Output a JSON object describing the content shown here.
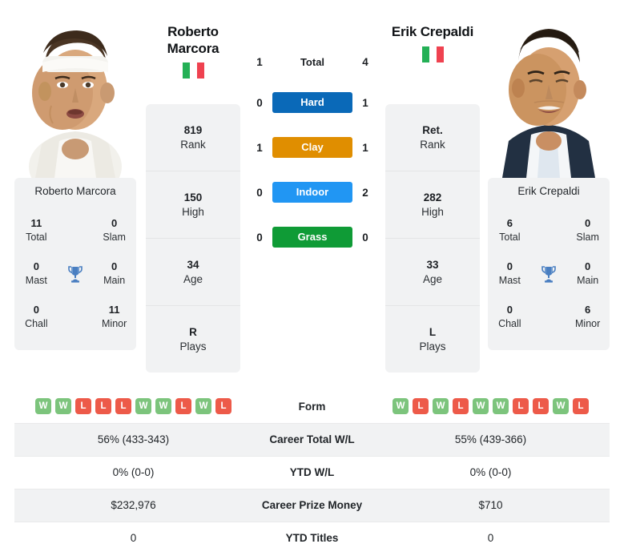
{
  "players": {
    "left": {
      "first_name": "Roberto",
      "last_name": "Marcora",
      "full_name": "Roberto Marcora",
      "country": "Italy",
      "flag_icon": "italy-flag-icon",
      "photo_alt": "Roberto Marcora headshot",
      "info": [
        {
          "value": "819",
          "label": "Rank"
        },
        {
          "value": "150",
          "label": "High"
        },
        {
          "value": "34",
          "label": "Age"
        },
        {
          "value": "R",
          "label": "Plays"
        }
      ],
      "titles": [
        {
          "value": "11",
          "label": "Total"
        },
        {
          "value": "0",
          "label": "Slam"
        },
        {
          "value": "0",
          "label": "Mast"
        },
        {
          "value": "0",
          "label": "Main"
        },
        {
          "value": "0",
          "label": "Chall"
        },
        {
          "value": "11",
          "label": "Minor"
        }
      ],
      "form": [
        "W",
        "W",
        "L",
        "L",
        "L",
        "W",
        "W",
        "L",
        "W",
        "L"
      ],
      "career_total_wl": "56% (433-343)",
      "ytd_wl": "0% (0-0)",
      "career_prize_money": "$232,976",
      "ytd_titles": "0"
    },
    "right": {
      "first_name": "Erik",
      "last_name": "Crepaldi",
      "full_name": "Erik Crepaldi",
      "country": "Italy",
      "flag_icon": "italy-flag-icon",
      "photo_alt": "Erik Crepaldi headshot",
      "info": [
        {
          "value": "Ret.",
          "label": "Rank"
        },
        {
          "value": "282",
          "label": "High"
        },
        {
          "value": "33",
          "label": "Age"
        },
        {
          "value": "L",
          "label": "Plays"
        }
      ],
      "titles": [
        {
          "value": "6",
          "label": "Total"
        },
        {
          "value": "0",
          "label": "Slam"
        },
        {
          "value": "0",
          "label": "Mast"
        },
        {
          "value": "0",
          "label": "Main"
        },
        {
          "value": "0",
          "label": "Chall"
        },
        {
          "value": "6",
          "label": "Minor"
        }
      ],
      "form": [
        "W",
        "L",
        "W",
        "L",
        "W",
        "W",
        "L",
        "L",
        "W",
        "L"
      ],
      "career_total_wl": "55% (439-366)",
      "ytd_wl": "0% (0-0)",
      "career_prize_money": "$710",
      "ytd_titles": "0"
    }
  },
  "h2h": {
    "rows": [
      {
        "label": "Total",
        "left": "1",
        "right": "4",
        "color": "none",
        "style": "plain"
      },
      {
        "label": "Hard",
        "left": "0",
        "right": "1",
        "color": "#0a69b8",
        "style": "pill"
      },
      {
        "label": "Clay",
        "left": "1",
        "right": "1",
        "color": "#e08e00",
        "style": "pill"
      },
      {
        "label": "Indoor",
        "left": "0",
        "right": "2",
        "color": "#2196f3",
        "style": "pill"
      },
      {
        "label": "Grass",
        "left": "0",
        "right": "0",
        "color": "#0f9b36",
        "style": "pill"
      }
    ]
  },
  "stats_rows": [
    {
      "label": "Form",
      "key": "form",
      "type": "form",
      "shaded": false
    },
    {
      "label": "Career Total W/L",
      "key": "career_total_wl",
      "type": "text",
      "shaded": true
    },
    {
      "label": "YTD W/L",
      "key": "ytd_wl",
      "type": "text",
      "shaded": false
    },
    {
      "label": "Career Prize Money",
      "key": "career_prize_money",
      "type": "text",
      "shaded": true
    },
    {
      "label": "YTD Titles",
      "key": "ytd_titles",
      "type": "text",
      "shaded": false
    }
  ],
  "icons": {
    "trophy": "trophy-icon"
  },
  "colors": {
    "card_bg": "#f1f2f3",
    "win": "#7cc47c",
    "loss": "#ed5a49",
    "trophy": "#4a7fc1",
    "hard": "#0a69b8",
    "clay": "#e08e00",
    "indoor": "#2196f3",
    "grass": "#0f9b36"
  }
}
